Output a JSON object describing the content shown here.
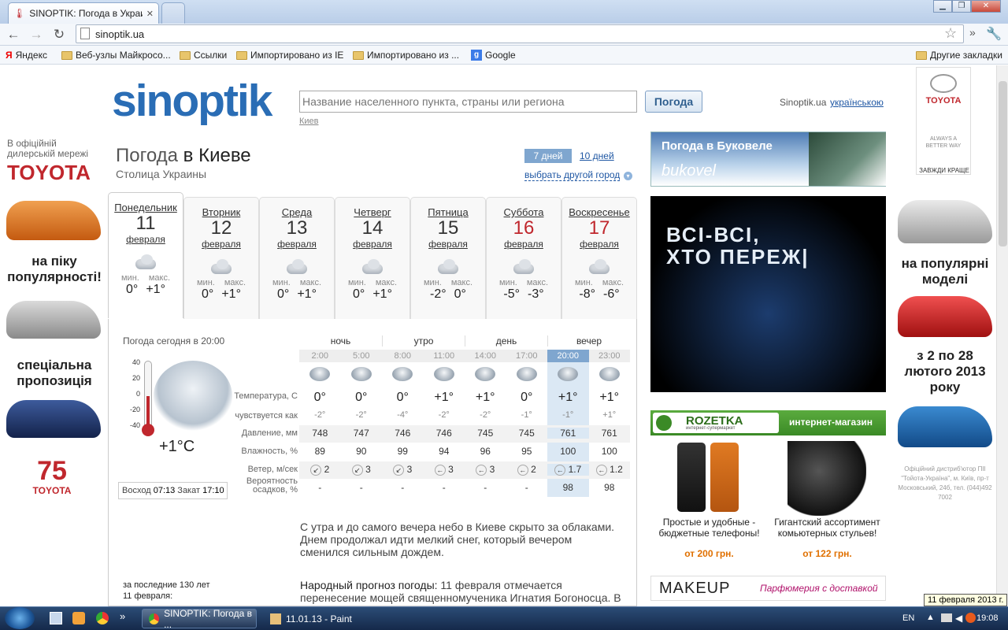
{
  "browser": {
    "tab_title": "SINOPTIK: Погода в Украи",
    "url": "sinoptik.ua"
  },
  "bookmarks": [
    "Яндекс",
    "Веб-узлы Майкросо...",
    "Ссылки",
    "Импортировано из IE",
    "Импортировано из ...",
    "Google"
  ],
  "bookmarks_other": "Другие закладки",
  "site": {
    "logo": "sinoptik",
    "search_placeholder": "Название населенного пункта, страны или региона",
    "search_button": "Погода",
    "recent_city": "Киев",
    "lang_prefix": "Sinoptik.ua",
    "lang_link": "українською"
  },
  "header": {
    "title_prefix": "Погода",
    "title_city": "в Киеве",
    "subtitle": "Столица Украины",
    "tab7": "7 дней",
    "tab10": "10 дней",
    "other_city": "выбрать другой город"
  },
  "days": [
    {
      "name": "Понедельник",
      "num": "11",
      "month": "февраля",
      "min": "0°",
      "max": "+1°",
      "weekend": false
    },
    {
      "name": "Вторник",
      "num": "12",
      "month": "февраля",
      "min": "0°",
      "max": "+1°",
      "weekend": false
    },
    {
      "name": "Среда",
      "num": "13",
      "month": "февраля",
      "min": "0°",
      "max": "+1°",
      "weekend": false
    },
    {
      "name": "Четверг",
      "num": "14",
      "month": "февраля",
      "min": "0°",
      "max": "+1°",
      "weekend": false
    },
    {
      "name": "Пятница",
      "num": "15",
      "month": "февраля",
      "min": "-2°",
      "max": "0°",
      "weekend": false
    },
    {
      "name": "Суббота",
      "num": "16",
      "month": "февраля",
      "min": "-5°",
      "max": "-3°",
      "weekend": true
    },
    {
      "name": "Воскресенье",
      "num": "17",
      "month": "февраля",
      "min": "-8°",
      "max": "-6°",
      "weekend": true
    }
  ],
  "minmax_labels": {
    "min": "мин.",
    "max": "макс."
  },
  "today": {
    "heading": "Погода сегодня в 20:00",
    "temp": "+1°C",
    "sunrise_label": "Восход",
    "sunrise": "07:13",
    "sunset_label": "Закат",
    "sunset": "17:10",
    "thermo_ticks": [
      "40",
      "20",
      "0",
      "-20",
      "-40"
    ]
  },
  "periods": [
    "ночь",
    "утро",
    "день",
    "вечер"
  ],
  "times": [
    "2:00",
    "5:00",
    "8:00",
    "11:00",
    "14:00",
    "17:00",
    "20:00",
    "23:00"
  ],
  "row_labels": {
    "temp": "Температура, С",
    "feels": "чувствуется как",
    "pressure": "Давление, мм",
    "humidity": "Влажность, %",
    "wind": "Ветер, м/сек",
    "precip": "Вероятность осадков, %"
  },
  "temps": [
    "0°",
    "0°",
    "0°",
    "+1°",
    "+1°",
    "0°",
    "+1°",
    "+1°"
  ],
  "feels": [
    "-2°",
    "-2°",
    "-4°",
    "-2°",
    "-2°",
    "-1°",
    "-1°",
    "+1°"
  ],
  "pressure": [
    "748",
    "747",
    "746",
    "746",
    "745",
    "745",
    "761",
    "761"
  ],
  "humidity": [
    "89",
    "90",
    "99",
    "94",
    "96",
    "95",
    "100",
    "100"
  ],
  "wind": [
    {
      "dir": "↙",
      "v": "2"
    },
    {
      "dir": "↙",
      "v": "3"
    },
    {
      "dir": "↙",
      "v": "3"
    },
    {
      "dir": "←",
      "v": "3"
    },
    {
      "dir": "←",
      "v": "3"
    },
    {
      "dir": "←",
      "v": "2"
    },
    {
      "dir": "←",
      "v": "1.7"
    },
    {
      "dir": "←",
      "v": "1.2"
    }
  ],
  "precip": [
    "-",
    "-",
    "-",
    "-",
    "-",
    "-",
    "98",
    "98"
  ],
  "description": "С утра и до самого вечера небо в Киеве скрыто за облаками. Днем продолжал идти мелкий снег, который вечером сменился сильным дождем.",
  "history": {
    "line1": "за последние 130 лет",
    "line2": "11 февраля:"
  },
  "folk": {
    "label": "Народный прогноз погоды:",
    "text": "11 февраля отмечается перенесение мощей священномученика Игнатия Богоносца. В"
  },
  "ads": {
    "bukovel_title": "Погода в Буковеле",
    "bukovel_logo": "bukovel",
    "banner_text1": "ВСІ-ВСІ,",
    "banner_text2": "ХТО ПЕРЕЖ|",
    "rozetka": "ROZETKA",
    "rozetka_sub": "интернет-супермаркет",
    "rozetka_right": "интернет-магазин",
    "item1": "Простые и удобные - бюджетные телефоны!",
    "price1": "от 200 грн.",
    "item2": "Гигантский ассортимент комьютерных стульев!",
    "price2": "от 122 грн.",
    "makeup": "MAKEUP",
    "makeup_right": "Парфюмерия с доставкой",
    "toyota_left_top": "В офіційній дилерській мережі",
    "toyota_brand": "TOYOTA",
    "left_slogan1": "на піку популярності!",
    "left_slogan2": "спеціальна пропозиція",
    "toyota75": "75",
    "toyota_right_slogan": "ALWAYS A BETTER WAY",
    "toyota_right_sub": "ЗАВЖДИ КРАЩЕ",
    "right_slogan1": "на популярні моделі",
    "right_slogan2": "з 2 по 28 лютого 2013 року",
    "right_dist": "Офіційний дистриб'ютор ПІІ \"Тойота-Україна\", м. Київ, пр-т Московський, 24б, тел. (044)492 7002"
  },
  "taskbar": {
    "item1": "SINOPTIK: Погода в ...",
    "item2": "11.01.13 - Paint",
    "lang": "EN",
    "time": "19:08",
    "tooltip": "11 февраля 2013 г."
  }
}
